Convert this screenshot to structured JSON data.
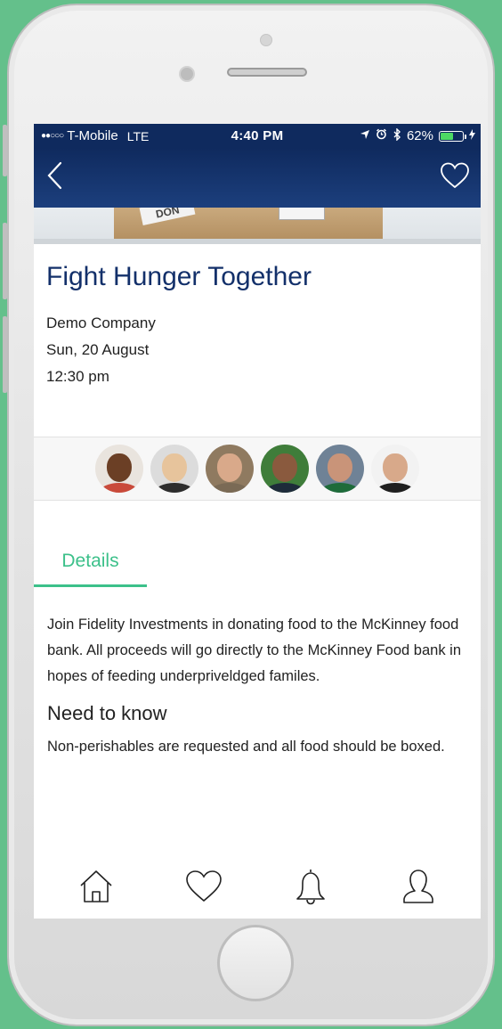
{
  "status_bar": {
    "carrier": "T-Mobile",
    "network": "LTE",
    "time": "4:40 PM",
    "battery": "62%",
    "battery_level": 0.62,
    "signal_dots": "●●○○○"
  },
  "nav": {
    "back_icon": "chevron-left-icon",
    "favorite_icon": "heart-icon"
  },
  "event": {
    "title": "Fight Hunger Together",
    "organizer": "Demo Company",
    "date": "Sun, 20 August",
    "time": "12:30 pm"
  },
  "attendees": [
    {
      "skin": "#6b3f25",
      "shirt": "#c94a3a",
      "bg": "#e9e4de"
    },
    {
      "skin": "#e7c49c",
      "shirt": "#2d2d2d",
      "bg": "#dcdcdc"
    },
    {
      "skin": "#d9a98a",
      "shirt": "#7a6a55",
      "bg": "#8f7a60"
    },
    {
      "skin": "#8a5a3e",
      "shirt": "#1e2b3a",
      "bg": "#3f7d3a"
    },
    {
      "skin": "#c99479",
      "shirt": "#1e6b3a",
      "bg": "#6f8296"
    },
    {
      "skin": "#d8a98a",
      "shirt": "#1f1f1f",
      "bg": "#f2f2f2"
    }
  ],
  "hero": {
    "box_tag": "DON"
  },
  "tabs": [
    {
      "label": "Details",
      "active": true
    }
  ],
  "details": {
    "description": "Join Fidelity Investments in donating food to the McKinney food bank. All proceeds will go directly to the McKinney Food bank in hopes of feeding underpriveldged familes.",
    "need_to_know_heading": "Need to know",
    "need_to_know_text": "Non-perishables are requested and all food should be boxed."
  },
  "tab_bar": {
    "items": [
      "home-icon",
      "heart-icon",
      "bell-icon",
      "profile-icon"
    ]
  },
  "colors": {
    "navy": "#0f2a5e",
    "accent_green": "#3cc08a",
    "title_blue": "#13306a",
    "background_green": "#64c08b"
  }
}
